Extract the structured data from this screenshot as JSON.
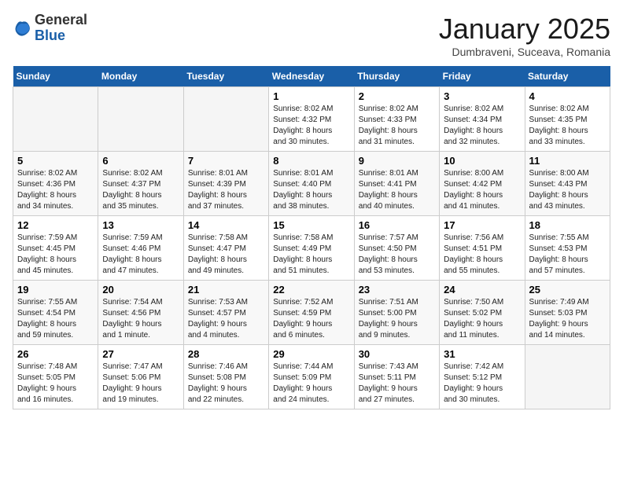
{
  "header": {
    "logo_general": "General",
    "logo_blue": "Blue",
    "month_title": "January 2025",
    "location": "Dumbraveni, Suceava, Romania"
  },
  "days_of_week": [
    "Sunday",
    "Monday",
    "Tuesday",
    "Wednesday",
    "Thursday",
    "Friday",
    "Saturday"
  ],
  "weeks": [
    [
      {
        "day": "",
        "info": ""
      },
      {
        "day": "",
        "info": ""
      },
      {
        "day": "",
        "info": ""
      },
      {
        "day": "1",
        "info": "Sunrise: 8:02 AM\nSunset: 4:32 PM\nDaylight: 8 hours\nand 30 minutes."
      },
      {
        "day": "2",
        "info": "Sunrise: 8:02 AM\nSunset: 4:33 PM\nDaylight: 8 hours\nand 31 minutes."
      },
      {
        "day": "3",
        "info": "Sunrise: 8:02 AM\nSunset: 4:34 PM\nDaylight: 8 hours\nand 32 minutes."
      },
      {
        "day": "4",
        "info": "Sunrise: 8:02 AM\nSunset: 4:35 PM\nDaylight: 8 hours\nand 33 minutes."
      }
    ],
    [
      {
        "day": "5",
        "info": "Sunrise: 8:02 AM\nSunset: 4:36 PM\nDaylight: 8 hours\nand 34 minutes."
      },
      {
        "day": "6",
        "info": "Sunrise: 8:02 AM\nSunset: 4:37 PM\nDaylight: 8 hours\nand 35 minutes."
      },
      {
        "day": "7",
        "info": "Sunrise: 8:01 AM\nSunset: 4:39 PM\nDaylight: 8 hours\nand 37 minutes."
      },
      {
        "day": "8",
        "info": "Sunrise: 8:01 AM\nSunset: 4:40 PM\nDaylight: 8 hours\nand 38 minutes."
      },
      {
        "day": "9",
        "info": "Sunrise: 8:01 AM\nSunset: 4:41 PM\nDaylight: 8 hours\nand 40 minutes."
      },
      {
        "day": "10",
        "info": "Sunrise: 8:00 AM\nSunset: 4:42 PM\nDaylight: 8 hours\nand 41 minutes."
      },
      {
        "day": "11",
        "info": "Sunrise: 8:00 AM\nSunset: 4:43 PM\nDaylight: 8 hours\nand 43 minutes."
      }
    ],
    [
      {
        "day": "12",
        "info": "Sunrise: 7:59 AM\nSunset: 4:45 PM\nDaylight: 8 hours\nand 45 minutes."
      },
      {
        "day": "13",
        "info": "Sunrise: 7:59 AM\nSunset: 4:46 PM\nDaylight: 8 hours\nand 47 minutes."
      },
      {
        "day": "14",
        "info": "Sunrise: 7:58 AM\nSunset: 4:47 PM\nDaylight: 8 hours\nand 49 minutes."
      },
      {
        "day": "15",
        "info": "Sunrise: 7:58 AM\nSunset: 4:49 PM\nDaylight: 8 hours\nand 51 minutes."
      },
      {
        "day": "16",
        "info": "Sunrise: 7:57 AM\nSunset: 4:50 PM\nDaylight: 8 hours\nand 53 minutes."
      },
      {
        "day": "17",
        "info": "Sunrise: 7:56 AM\nSunset: 4:51 PM\nDaylight: 8 hours\nand 55 minutes."
      },
      {
        "day": "18",
        "info": "Sunrise: 7:55 AM\nSunset: 4:53 PM\nDaylight: 8 hours\nand 57 minutes."
      }
    ],
    [
      {
        "day": "19",
        "info": "Sunrise: 7:55 AM\nSunset: 4:54 PM\nDaylight: 8 hours\nand 59 minutes."
      },
      {
        "day": "20",
        "info": "Sunrise: 7:54 AM\nSunset: 4:56 PM\nDaylight: 9 hours\nand 1 minute."
      },
      {
        "day": "21",
        "info": "Sunrise: 7:53 AM\nSunset: 4:57 PM\nDaylight: 9 hours\nand 4 minutes."
      },
      {
        "day": "22",
        "info": "Sunrise: 7:52 AM\nSunset: 4:59 PM\nDaylight: 9 hours\nand 6 minutes."
      },
      {
        "day": "23",
        "info": "Sunrise: 7:51 AM\nSunset: 5:00 PM\nDaylight: 9 hours\nand 9 minutes."
      },
      {
        "day": "24",
        "info": "Sunrise: 7:50 AM\nSunset: 5:02 PM\nDaylight: 9 hours\nand 11 minutes."
      },
      {
        "day": "25",
        "info": "Sunrise: 7:49 AM\nSunset: 5:03 PM\nDaylight: 9 hours\nand 14 minutes."
      }
    ],
    [
      {
        "day": "26",
        "info": "Sunrise: 7:48 AM\nSunset: 5:05 PM\nDaylight: 9 hours\nand 16 minutes."
      },
      {
        "day": "27",
        "info": "Sunrise: 7:47 AM\nSunset: 5:06 PM\nDaylight: 9 hours\nand 19 minutes."
      },
      {
        "day": "28",
        "info": "Sunrise: 7:46 AM\nSunset: 5:08 PM\nDaylight: 9 hours\nand 22 minutes."
      },
      {
        "day": "29",
        "info": "Sunrise: 7:44 AM\nSunset: 5:09 PM\nDaylight: 9 hours\nand 24 minutes."
      },
      {
        "day": "30",
        "info": "Sunrise: 7:43 AM\nSunset: 5:11 PM\nDaylight: 9 hours\nand 27 minutes."
      },
      {
        "day": "31",
        "info": "Sunrise: 7:42 AM\nSunset: 5:12 PM\nDaylight: 9 hours\nand 30 minutes."
      },
      {
        "day": "",
        "info": ""
      }
    ]
  ]
}
